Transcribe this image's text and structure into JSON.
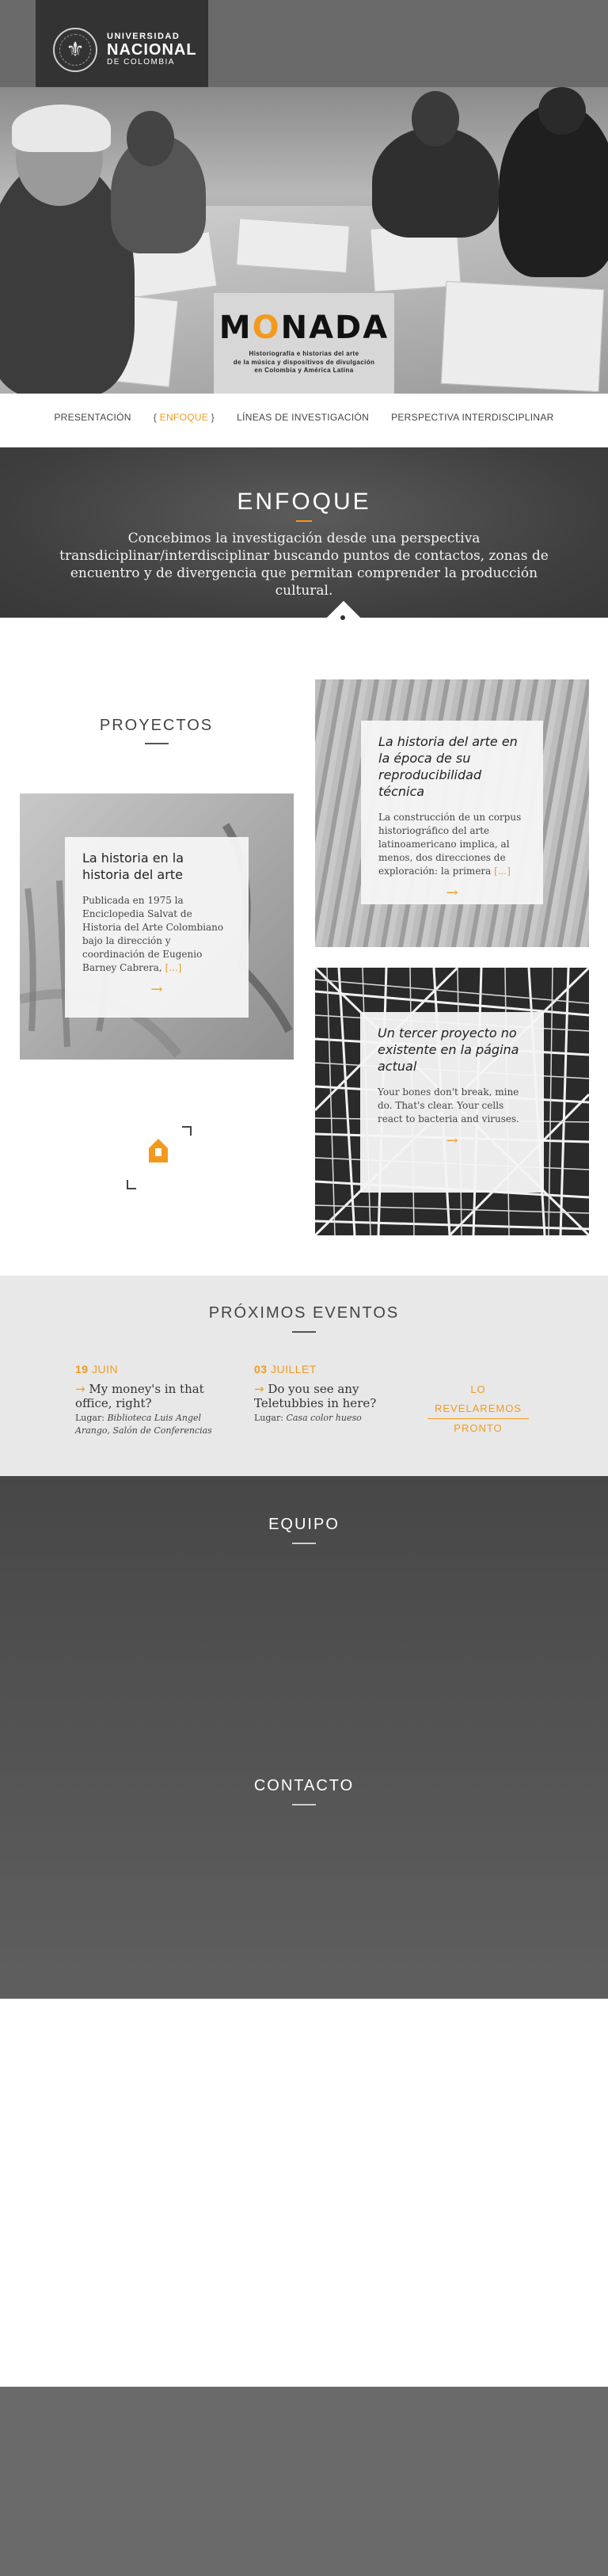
{
  "header": {
    "university_line1": "UNIVERSIDAD",
    "university_line2": "NACIONAL",
    "university_line3": "DE COLOMBIA"
  },
  "hero": {
    "brand": "MONADA",
    "brand_subtitle_1": "Historiografía e historias del arte",
    "brand_subtitle_2": "de la música y dispositivos de divulgación",
    "brand_subtitle_3": "en Colombia y América Latina"
  },
  "nav": {
    "items": [
      {
        "label": "PRESENTACIÓN"
      },
      {
        "label": "ENFOQUE"
      },
      {
        "label": "LÍNEAS DE INVESTIGACIÓN"
      },
      {
        "label": "PERSPECTIVA INTERDISCIPLINAR"
      }
    ]
  },
  "enfoque": {
    "title": "ENFOQUE",
    "text": "Concebimos la investigación desde una perspectiva transdiciplinar/interdisciplinar buscando puntos de contactos, zonas de encuentro y de divergencia que permitan comprender la producción cultural."
  },
  "proyectos": {
    "title": "PROYECTOS",
    "cards": [
      {
        "title": "La historia en la historia del arte",
        "text": "Publicada en 1975 la Enciclopedia Salvat de Historia del Arte Colombiano bajo la dirección y coordinación de Eugenio Barney Cabrera,",
        "more": "[...]",
        "arrow": "→"
      },
      {
        "title": "La historia del arte en la época de su reproducibilidad técnica",
        "text": "La construcción de un corpus historiográfico del arte latinoamericano implica, al menos, dos direcciones de exploración: la primera",
        "more": "[...]",
        "arrow": "→"
      },
      {
        "title": "Un tercer proyecto no existente en la página actual",
        "text": "Your bones don't break, mine do. That's clear. Your cells react to bacteria and viruses.",
        "more": "",
        "arrow": "→"
      }
    ]
  },
  "eventos": {
    "title": "PRÓXIMOS EVENTOS",
    "items": [
      {
        "day": "19",
        "month": "JUIN",
        "arrow": "→",
        "title": "My money's in that office, right?",
        "place_label": "Lugar:",
        "place": "Biblioteca Luis Angel Arango, Salón de Conferencias"
      },
      {
        "day": "03",
        "month": "JUILLET",
        "arrow": "→",
        "title": "Do you see any Teletubbies in here?",
        "place_label": "Lugar:",
        "place": "Casa color hueso"
      }
    ],
    "reveal_line1": "LO REVELAREMOS",
    "reveal_line2": "PRONTO"
  },
  "equipo": {
    "title": "EQUIPO"
  },
  "contacto": {
    "title": "CONTACTO"
  },
  "colors": {
    "accent": "#f39a1e",
    "dark": "#333333",
    "gray": "#6a6a6a",
    "light": "#e8e8e8"
  },
  "icons": [
    "university-seal-icon",
    "monada-house-icon",
    "arrow-right-icon"
  ]
}
